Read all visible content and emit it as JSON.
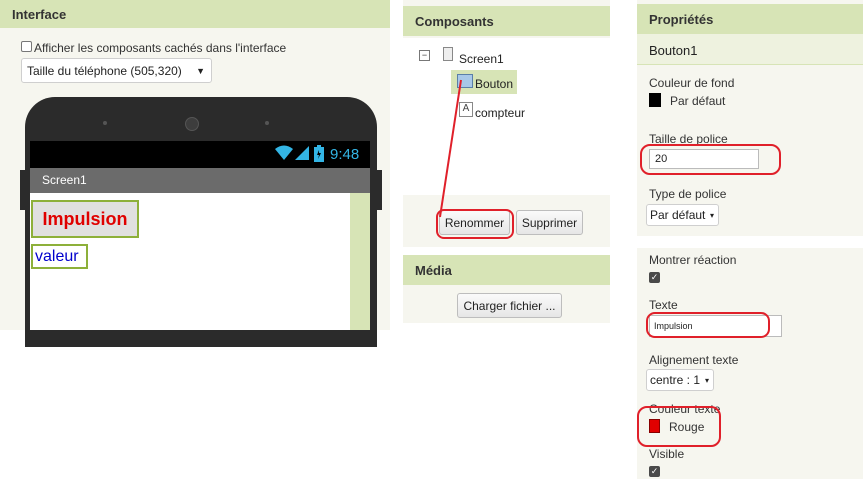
{
  "interface": {
    "header": "Interface",
    "show_hidden_label": "Afficher les composants cachés dans l'interface",
    "phone_size_value": "Taille du téléphone (505,320)",
    "status_time": "9:48",
    "screen_title": "Screen1",
    "button_text": "Impulsion",
    "label_text": "valeur"
  },
  "components": {
    "header": "Composants",
    "tree": [
      "Screen1",
      "Bouton",
      "compteur"
    ],
    "rename_label": "Renommer",
    "delete_label": "Supprimer"
  },
  "media": {
    "header": "Média",
    "upload_label": "Charger fichier ..."
  },
  "properties": {
    "header": "Propriétés",
    "component_name": "Bouton1",
    "bg_color_label": "Couleur de fond",
    "bg_color_value": "Par défaut",
    "font_size_label": "Taille de police",
    "font_size_value": "20",
    "font_type_label": "Type de police",
    "font_type_value": "Par défaut",
    "show_feedback_label": "Montrer réaction",
    "text_label": "Texte",
    "text_value": "Impulsion",
    "text_align_label": "Alignement texte",
    "text_align_value": "centre : 1",
    "text_color_label": "Couleur texte",
    "text_color_value": "Rouge",
    "visible_label": "Visible"
  },
  "colors": {
    "header_green": "#d7e4b6",
    "highlight_red": "#e0202a",
    "status_blue": "#33b5e5",
    "button_text_red": "#e00000",
    "label_text_blue": "#0000cc"
  }
}
